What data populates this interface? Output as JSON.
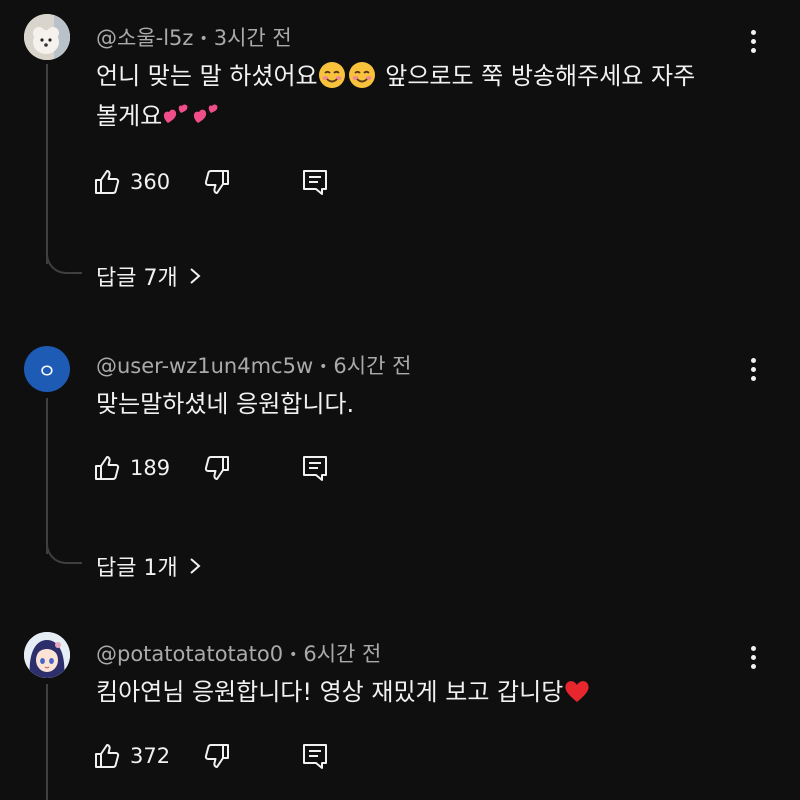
{
  "comments": [
    {
      "author": "@소울-l5z",
      "time": "3시간 전",
      "text_main": "언니 맞는 말 하셨어요",
      "text_mid": " 앞으로도 쭉 방송해주세요 자주 볼게요",
      "likes": "360",
      "replies_label": "답글 7개",
      "avatar_icon": "dog-avatar"
    },
    {
      "author": "@user-wz1un4mc5w",
      "time": "6시간 전",
      "text": "맞는말하셨네 응원합니다.",
      "likes": "189",
      "replies_label": "답글 1개",
      "avatar_letter": "ㅇ",
      "avatar_color": "#1e5bb5"
    },
    {
      "author": "@potatotatotato0",
      "time": "6시간 전",
      "text": "킴아연님 응원합니다! 영상 재밌게 보고 갑니당",
      "likes": "372",
      "avatar_icon": "anime-avatar"
    }
  ],
  "icons": {
    "like": "thumbs-up-icon",
    "dislike": "thumbs-down-icon",
    "reply": "reply-icon",
    "more": "more-vertical-icon",
    "chevron": "chevron-right-icon",
    "emoji_smile": "smiling-face-emoji",
    "emoji_hearts": "two-hearts-emoji",
    "emoji_heart": "red-heart-emoji"
  },
  "colors": {
    "background": "#0f0f0f",
    "text": "#f1f1f1",
    "secondary": "#aaaaaa",
    "thread": "#3f3f3f"
  }
}
